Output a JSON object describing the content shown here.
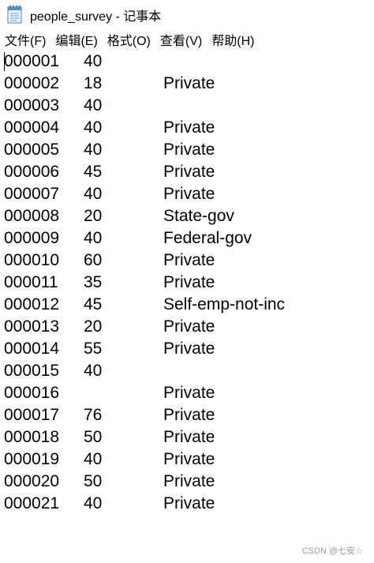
{
  "window": {
    "title": "people_survey - 记事本",
    "icon": "notepad-icon"
  },
  "menu": [
    {
      "label": "文件(F)"
    },
    {
      "label": "编辑(E)"
    },
    {
      "label": "格式(O)"
    },
    {
      "label": "查看(V)"
    },
    {
      "label": "帮助(H)"
    }
  ],
  "editor": {
    "rows": [
      {
        "id": "000001",
        "age": "40",
        "workclass": ""
      },
      {
        "id": "000002",
        "age": "18",
        "workclass": "Private"
      },
      {
        "id": "000003",
        "age": "40",
        "workclass": ""
      },
      {
        "id": "000004",
        "age": "40",
        "workclass": "Private"
      },
      {
        "id": "000005",
        "age": "40",
        "workclass": "Private"
      },
      {
        "id": "000006",
        "age": "45",
        "workclass": "Private"
      },
      {
        "id": "000007",
        "age": "40",
        "workclass": "Private"
      },
      {
        "id": "000008",
        "age": "20",
        "workclass": "State-gov"
      },
      {
        "id": "000009",
        "age": "40",
        "workclass": "Federal-gov"
      },
      {
        "id": "000010",
        "age": "60",
        "workclass": "Private"
      },
      {
        "id": "000011",
        "age": "35",
        "workclass": "Private"
      },
      {
        "id": "000012",
        "age": "45",
        "workclass": "Self-emp-not-inc"
      },
      {
        "id": "000013",
        "age": "20",
        "workclass": "Private"
      },
      {
        "id": "000014",
        "age": "55",
        "workclass": "Private"
      },
      {
        "id": "000015",
        "age": "40",
        "workclass": ""
      },
      {
        "id": "000016",
        "age": "",
        "workclass": "Private"
      },
      {
        "id": "000017",
        "age": "76",
        "workclass": "Private"
      },
      {
        "id": "000018",
        "age": "50",
        "workclass": "Private"
      },
      {
        "id": "000019",
        "age": "40",
        "workclass": "Private"
      },
      {
        "id": "000020",
        "age": "50",
        "workclass": "Private"
      },
      {
        "id": "000021",
        "age": "40",
        "workclass": "Private"
      }
    ]
  },
  "watermark": "CSDN @七安☆"
}
